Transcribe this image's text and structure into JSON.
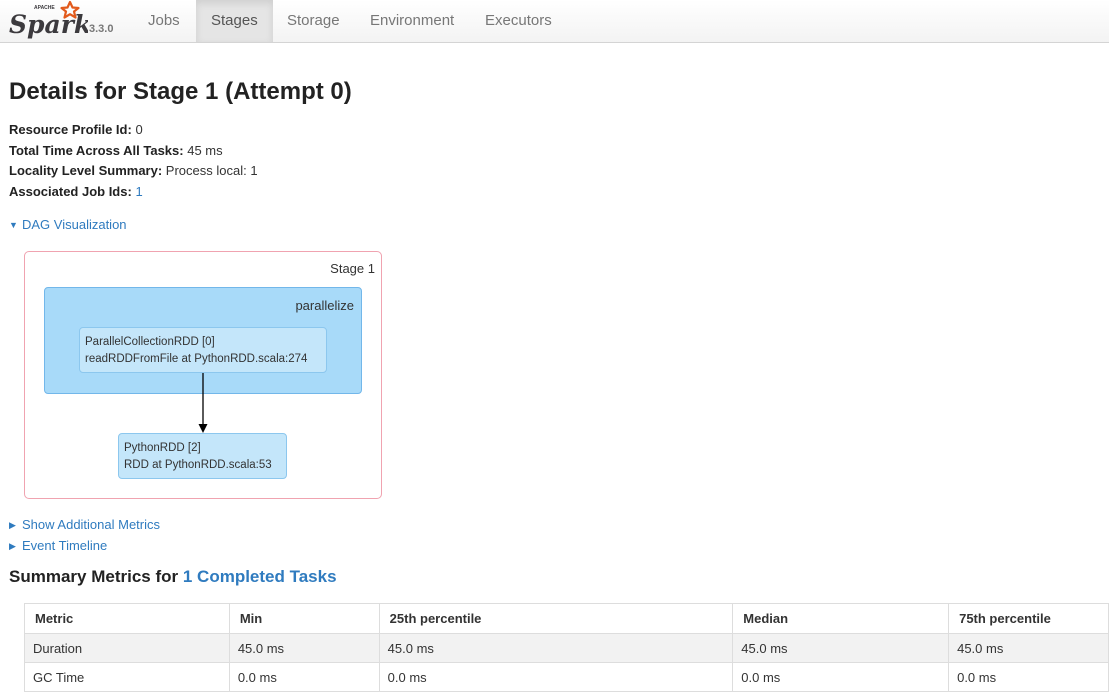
{
  "app": {
    "logo_text": "Spark",
    "logo_tagline": "APACHE",
    "version": "3.3.0",
    "tabs": [
      {
        "label": "Jobs",
        "active": false
      },
      {
        "label": "Stages",
        "active": true
      },
      {
        "label": "Storage",
        "active": false
      },
      {
        "label": "Environment",
        "active": false
      },
      {
        "label": "Executors",
        "active": false
      }
    ]
  },
  "page": {
    "title": "Details for Stage 1 (Attempt 0)",
    "summary": [
      {
        "label": "Resource Profile Id:",
        "value": "0"
      },
      {
        "label": "Total Time Across All Tasks:",
        "value": "45 ms"
      },
      {
        "label": "Locality Level Summary:",
        "value": "Process local: 1"
      },
      {
        "label": "Associated Job Ids:",
        "value": "1"
      }
    ]
  },
  "dag": {
    "toggle_label": "DAG Visualization",
    "stage_label": "Stage 1",
    "cluster_label": "parallelize",
    "nodes": [
      {
        "line1": "ParallelCollectionRDD [0]",
        "line2": "readRDDFromFile at PythonRDD.scala:274"
      },
      {
        "line1": "PythonRDD [2]",
        "line2": "RDD at PythonRDD.scala:53"
      }
    ]
  },
  "expanders": {
    "additional_metrics": "Show Additional Metrics",
    "event_timeline": "Event Timeline"
  },
  "metrics": {
    "title_prefix": "Summary Metrics for",
    "title_link": "1 Completed Tasks",
    "columns": [
      "Metric",
      "Min",
      "25th percentile",
      "Median",
      "75th percentile"
    ],
    "rows": [
      [
        "Duration",
        "45.0 ms",
        "45.0 ms",
        "45.0 ms",
        "45.0 ms"
      ],
      [
        "GC Time",
        "0.0 ms",
        "0.0 ms",
        "0.0 ms",
        "0.0 ms"
      ]
    ]
  },
  "colors": {
    "link": "#2f7bbf",
    "logo_orange": "#e25a1c",
    "logo_text": "#3c3a3e",
    "stage_border": "#f0a3b0",
    "cluster_fill": "#a8daf9",
    "node_fill": "#c4e6fa"
  }
}
